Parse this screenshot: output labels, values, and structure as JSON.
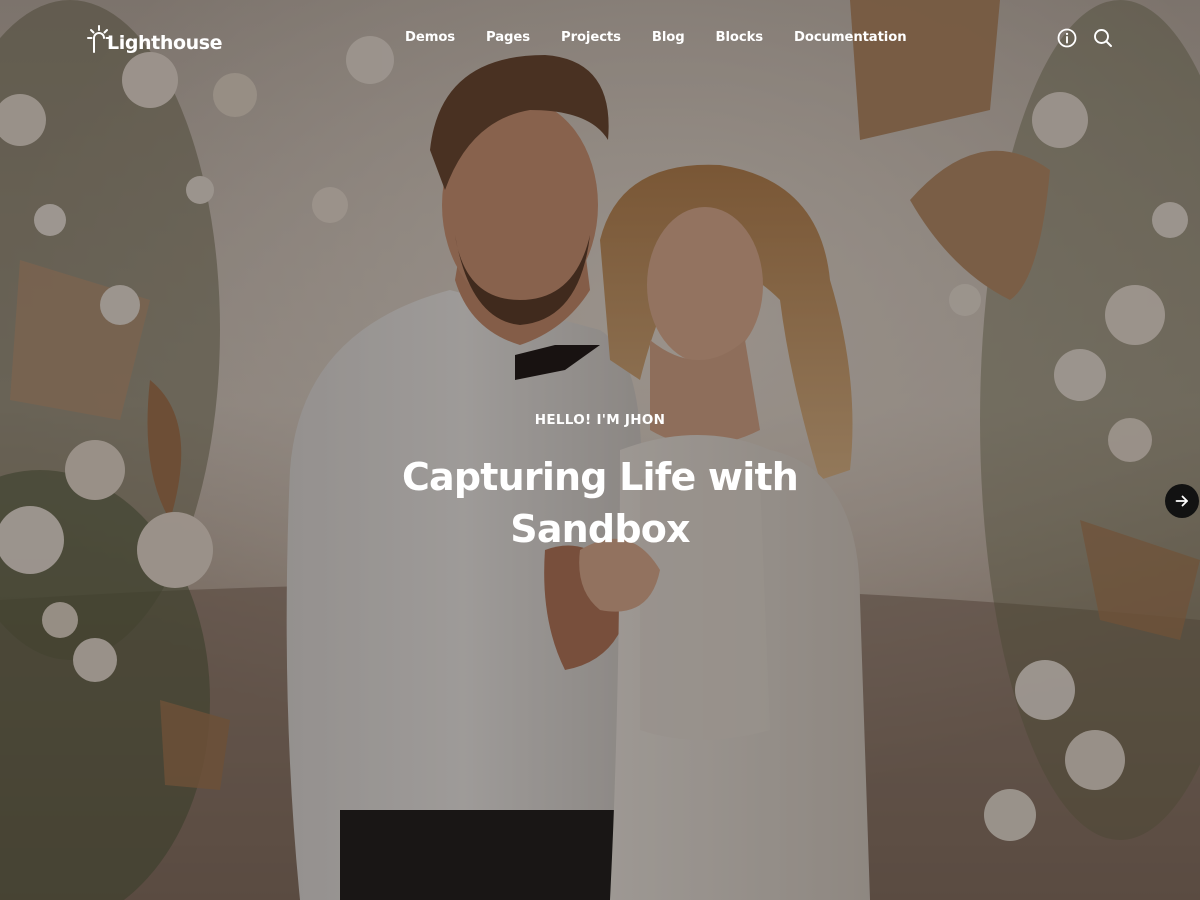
{
  "brand": {
    "name": "Lighthouse",
    "logo_icon": "sun-rays-icon"
  },
  "nav": {
    "items": [
      {
        "label": "Demos"
      },
      {
        "label": "Pages"
      },
      {
        "label": "Projects"
      },
      {
        "label": "Blog"
      },
      {
        "label": "Blocks"
      },
      {
        "label": "Documentation"
      }
    ],
    "icons": [
      "info-icon",
      "search-icon"
    ]
  },
  "hero": {
    "eyebrow": "HELLO! I'M JHON",
    "headline": "Capturing Life with Sandbox",
    "image_alt": "wedding-couple-photo",
    "next_icon": "arrow-right-icon"
  },
  "colors": {
    "text": "#ffffff",
    "overlay": "#14100e",
    "arrow_button": "#121212"
  }
}
